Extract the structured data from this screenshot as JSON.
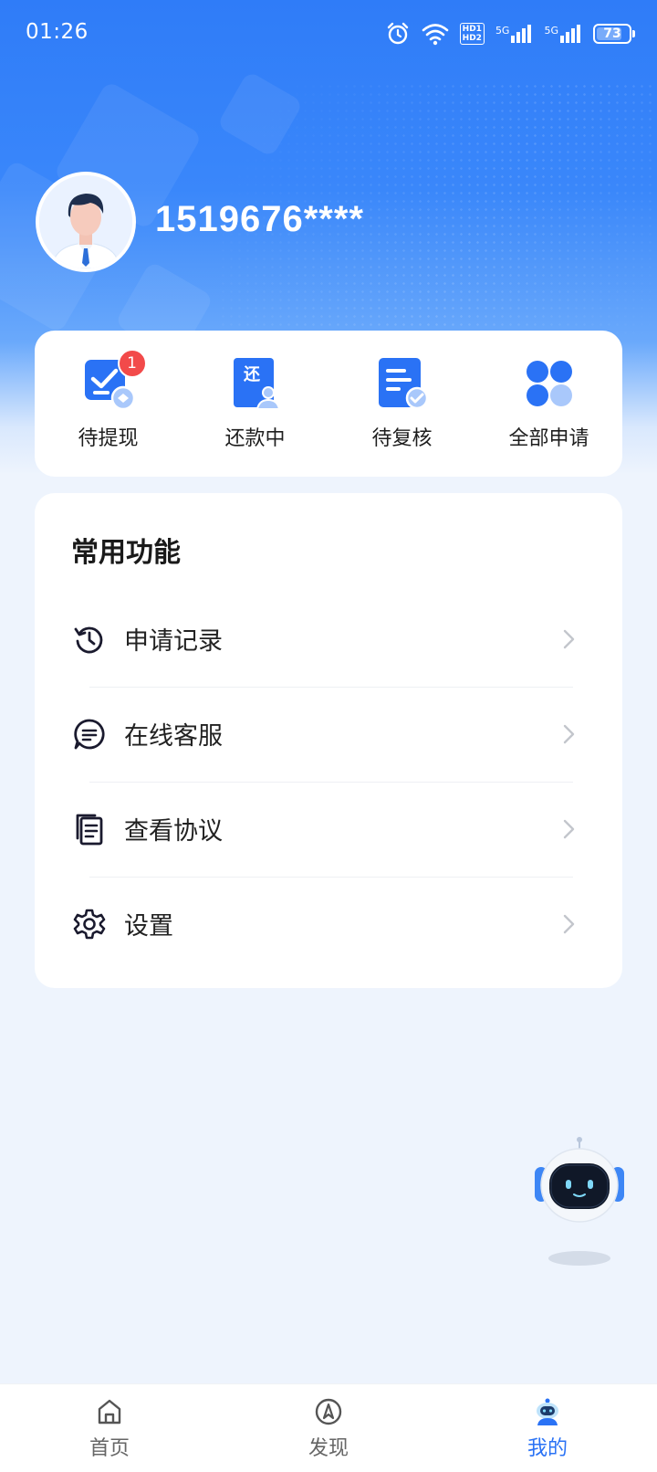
{
  "status_bar": {
    "time": "01:26",
    "network_1": "5G",
    "network_2": "5G",
    "hd_1": "HD1",
    "hd_2": "HD2",
    "battery": "73"
  },
  "profile": {
    "phone": "1519676****"
  },
  "quick_actions": [
    {
      "label": "待提现",
      "icon": "pending-withdraw-icon",
      "badge": "1"
    },
    {
      "label": "还款中",
      "icon": "repaying-icon"
    },
    {
      "label": "待复核",
      "icon": "pending-review-icon"
    },
    {
      "label": "全部申请",
      "icon": "all-applications-icon"
    }
  ],
  "common_functions": {
    "title": "常用功能",
    "items": [
      {
        "label": "申请记录",
        "icon": "history-icon"
      },
      {
        "label": "在线客服",
        "icon": "chat-icon"
      },
      {
        "label": "查看协议",
        "icon": "document-icon"
      },
      {
        "label": "设置",
        "icon": "gear-icon"
      }
    ]
  },
  "bottom_nav": {
    "items": [
      {
        "label": "首页",
        "icon": "home-icon"
      },
      {
        "label": "发现",
        "icon": "compass-icon"
      },
      {
        "label": "我的",
        "icon": "profile-robot-icon",
        "active": true
      }
    ]
  },
  "colors": {
    "primary": "#2a72f5",
    "badge": "#f24a4a",
    "background": "#eef4fd"
  }
}
